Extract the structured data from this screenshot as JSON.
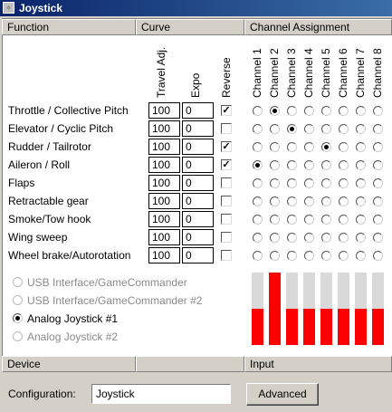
{
  "window": {
    "title": "Joystick",
    "icon": "joystick-app-icon"
  },
  "headers": {
    "function": "Function",
    "curve": "Curve",
    "channel_assignment": "Channel Assignment",
    "device": "Device",
    "input": "Input"
  },
  "columns": {
    "travel_adj": "Travel Adj.",
    "expo": "Expo",
    "reverse": "Reverse",
    "channels": [
      "Channel 1",
      "Channel 2",
      "Channel 3",
      "Channel 4",
      "Channel 5",
      "Channel 6",
      "Channel 7",
      "Channel 8"
    ]
  },
  "functions": [
    {
      "name": "Throttle / Collective Pitch",
      "travel": "100",
      "expo": "0",
      "reverse": true,
      "channel": 2
    },
    {
      "name": "Elevator / Cyclic Pitch",
      "travel": "100",
      "expo": "0",
      "reverse": false,
      "channel": 3
    },
    {
      "name": "Rudder / Tailrotor",
      "travel": "100",
      "expo": "0",
      "reverse": true,
      "channel": 5
    },
    {
      "name": "Aileron / Roll",
      "travel": "100",
      "expo": "0",
      "reverse": true,
      "channel": 1
    },
    {
      "name": "Flaps",
      "travel": "100",
      "expo": "0",
      "reverse": false,
      "channel": 0
    },
    {
      "name": "Retractable gear",
      "travel": "100",
      "expo": "0",
      "reverse": false,
      "channel": 0
    },
    {
      "name": "Smoke/Tow hook",
      "travel": "100",
      "expo": "0",
      "reverse": false,
      "channel": 0
    },
    {
      "name": "Wing sweep",
      "travel": "100",
      "expo": "0",
      "reverse": false,
      "channel": 0
    },
    {
      "name": "Wheel brake/Autorotation",
      "travel": "100",
      "expo": "0",
      "reverse": false,
      "channel": 0
    }
  ],
  "devices": [
    {
      "label": "USB Interface/GameCommander",
      "enabled": false,
      "selected": false
    },
    {
      "label": "USB Interface/GameCommander #2",
      "enabled": false,
      "selected": false
    },
    {
      "label": "Analog Joystick #1",
      "enabled": true,
      "selected": true
    },
    {
      "label": "Analog Joystick #2",
      "enabled": false,
      "selected": false
    }
  ],
  "input_levels": [
    0.5,
    1.0,
    0.5,
    0.5,
    0.5,
    0.5,
    0.5,
    0.5
  ],
  "input_color": "#ff0000",
  "configuration": {
    "label": "Configuration:",
    "value": "Joystick"
  },
  "advanced_button": "Advanced",
  "icons": {
    "checkmark": "checkmark-icon",
    "radio": "radio-dot-icon"
  }
}
